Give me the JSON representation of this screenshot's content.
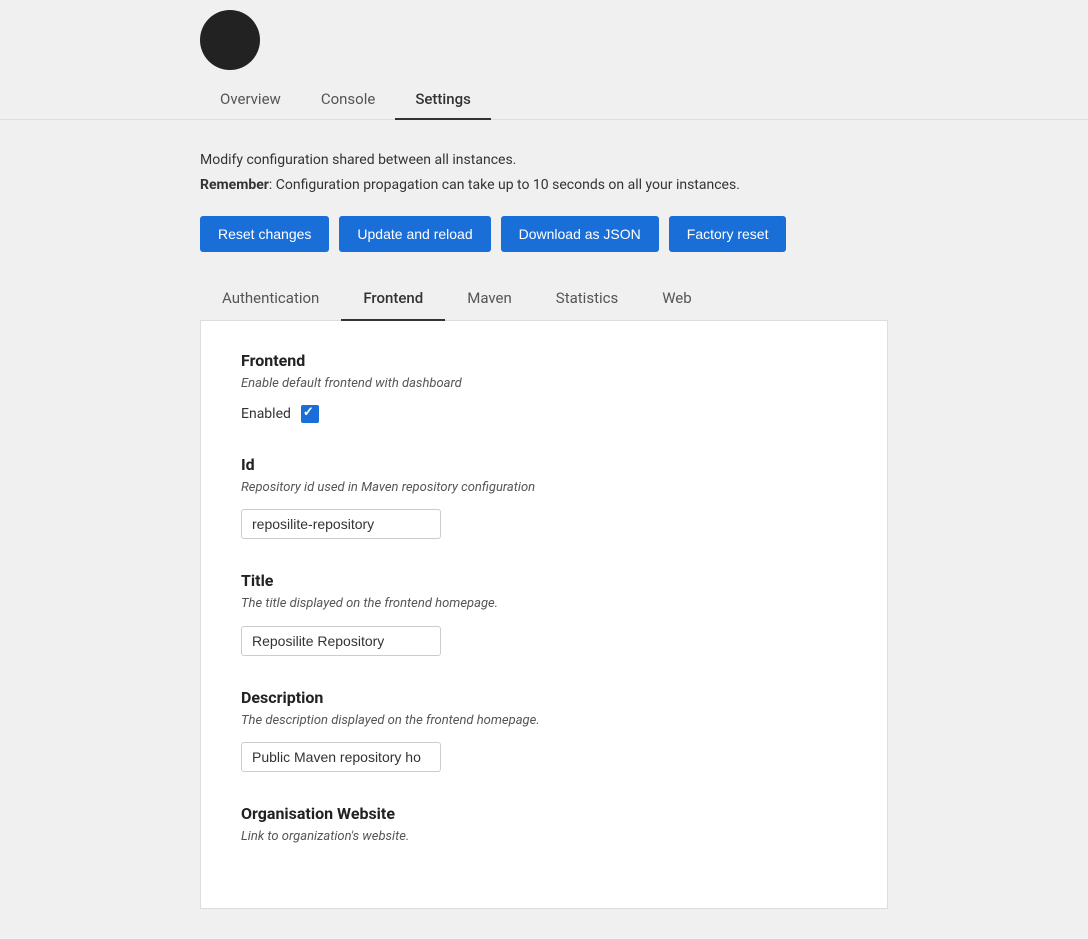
{
  "avatar": {
    "alt": "User avatar"
  },
  "top_nav": {
    "tabs": [
      {
        "label": "Overview",
        "active": false,
        "id": "overview"
      },
      {
        "label": "Console",
        "active": false,
        "id": "console"
      },
      {
        "label": "Settings",
        "active": true,
        "id": "settings"
      }
    ]
  },
  "info": {
    "line1": "Modify configuration shared between all instances.",
    "line2_prefix": "Remember",
    "line2_body": ": Configuration propagation can take up to 10 seconds on all your instances."
  },
  "buttons": [
    {
      "label": "Reset changes",
      "id": "reset-changes"
    },
    {
      "label": "Update and reload",
      "id": "update-reload"
    },
    {
      "label": "Download as JSON",
      "id": "download-json"
    },
    {
      "label": "Factory reset",
      "id": "factory-reset"
    }
  ],
  "settings_tabs": [
    {
      "label": "Authentication",
      "active": false,
      "id": "authentication"
    },
    {
      "label": "Frontend",
      "active": true,
      "id": "frontend"
    },
    {
      "label": "Maven",
      "active": false,
      "id": "maven"
    },
    {
      "label": "Statistics",
      "active": false,
      "id": "statistics"
    },
    {
      "label": "Web",
      "active": false,
      "id": "web"
    }
  ],
  "frontend_section": {
    "title": "Frontend",
    "desc": "Enable default frontend with dashboard",
    "enabled_label": "Enabled",
    "enabled_checked": true,
    "id_section": {
      "title": "Id",
      "desc": "Repository id used in Maven repository configuration",
      "value": "reposilite-repository"
    },
    "title_section": {
      "title": "Title",
      "desc": "The title displayed on the frontend homepage.",
      "value": "Reposilite Repository"
    },
    "description_section": {
      "title": "Description",
      "desc": "The description displayed on the frontend homepage.",
      "value": "Public Maven repository ho"
    },
    "org_website_section": {
      "title": "Organisation Website",
      "desc": "Link to organization's website."
    }
  }
}
